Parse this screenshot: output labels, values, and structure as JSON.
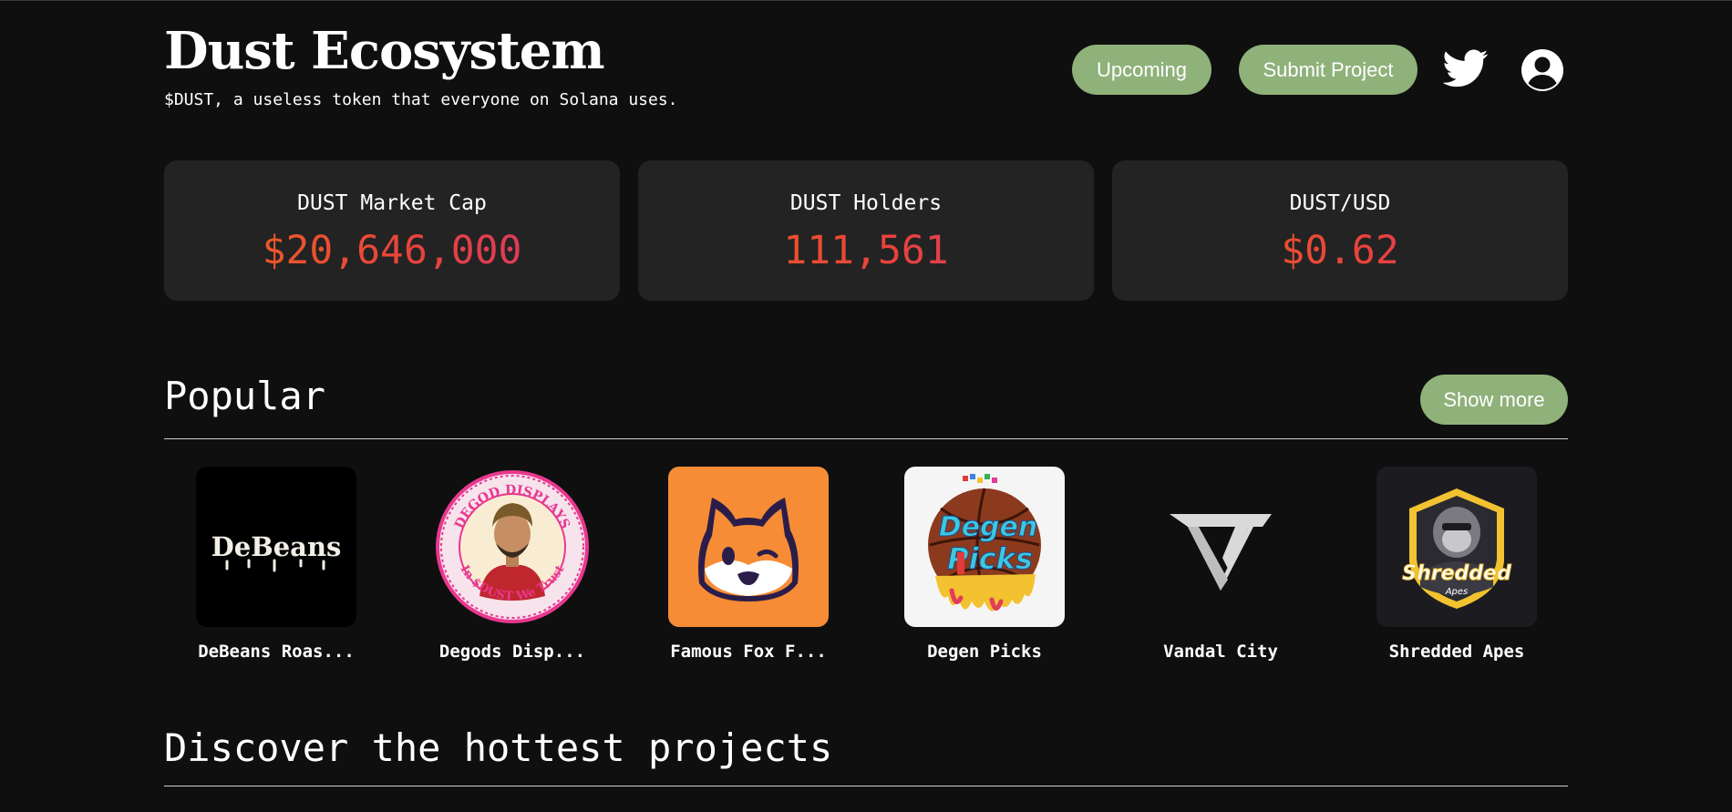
{
  "header": {
    "title": "Dust Ecosystem",
    "tagline": "$DUST, a useless token that everyone on Solana uses.",
    "buttons": {
      "upcoming": "Upcoming",
      "submit": "Submit Project"
    },
    "icons": {
      "social": "twitter-icon",
      "account": "user-circle-icon"
    }
  },
  "stats": [
    {
      "label": "DUST Market Cap",
      "value": "$20,646,000"
    },
    {
      "label": "DUST Holders",
      "value": "111,561"
    },
    {
      "label": "DUST/USD",
      "value": "$0.62"
    }
  ],
  "popular": {
    "title": "Popular",
    "show_more": "Show more",
    "items": [
      {
        "name": "DeBeans Roas...",
        "logo_text": "DeBeans",
        "bg": "#000000"
      },
      {
        "name": "Degods Disp...",
        "logo_text": "DEGOD DISPLAYS · In $DUST We Trust",
        "bg": "#0f0f0f"
      },
      {
        "name": "Famous Fox F...",
        "bg": "#f68c36"
      },
      {
        "name": "Degen Picks",
        "logo_text": "Degen Picks",
        "bg": "#f5f5f5"
      },
      {
        "name": "Vandal City",
        "bg": "#0f0f0f"
      },
      {
        "name": "Shredded Apes",
        "logo_text": "Shredded Apes",
        "bg": "#1c1c20"
      }
    ]
  },
  "discover": {
    "title": "Discover the hottest projects"
  },
  "colors": {
    "accent": "#8fb17a",
    "card_bg": "#232323",
    "page_bg": "#0f0f0f",
    "value_gradient": [
      "#f0651d",
      "#e8433c",
      "#d63574"
    ]
  }
}
